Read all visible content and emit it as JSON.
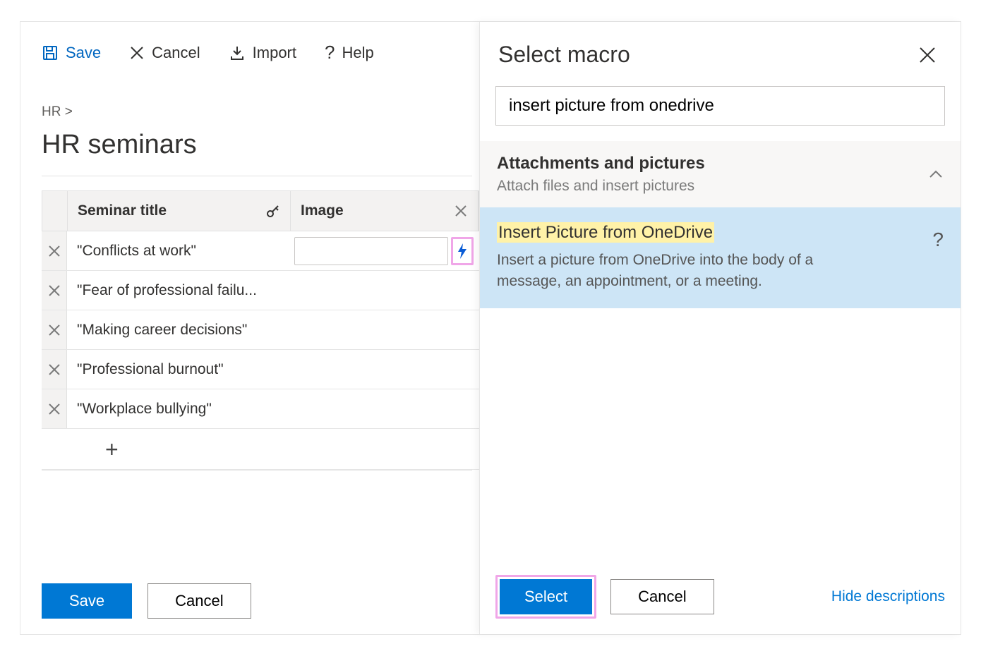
{
  "toolbar": {
    "save": "Save",
    "cancel": "Cancel",
    "import": "Import",
    "help": "Help"
  },
  "breadcrumb": "HR  >",
  "page_title": "HR seminars",
  "table": {
    "columns": {
      "title": "Seminar title",
      "image": "Image"
    },
    "rows": [
      {
        "title": "\"Conflicts at work\"",
        "active": true
      },
      {
        "title": "\"Fear of professional failu...",
        "active": false
      },
      {
        "title": "\"Making career decisions\"",
        "active": false
      },
      {
        "title": "\"Professional burnout\"",
        "active": false
      },
      {
        "title": "\"Workplace bullying\"",
        "active": false
      }
    ]
  },
  "footer": {
    "save": "Save",
    "cancel": "Cancel"
  },
  "panel": {
    "title": "Select macro",
    "search_value": "insert picture from onedrive",
    "group": {
      "title": "Attachments and pictures",
      "subtitle": "Attach files and insert pictures"
    },
    "macro": {
      "name": "Insert Picture from OneDrive",
      "desc": "Insert a picture from OneDrive into the body of a message, an appointment, or a meeting."
    },
    "select": "Select",
    "cancel": "Cancel",
    "hide": "Hide descriptions"
  }
}
